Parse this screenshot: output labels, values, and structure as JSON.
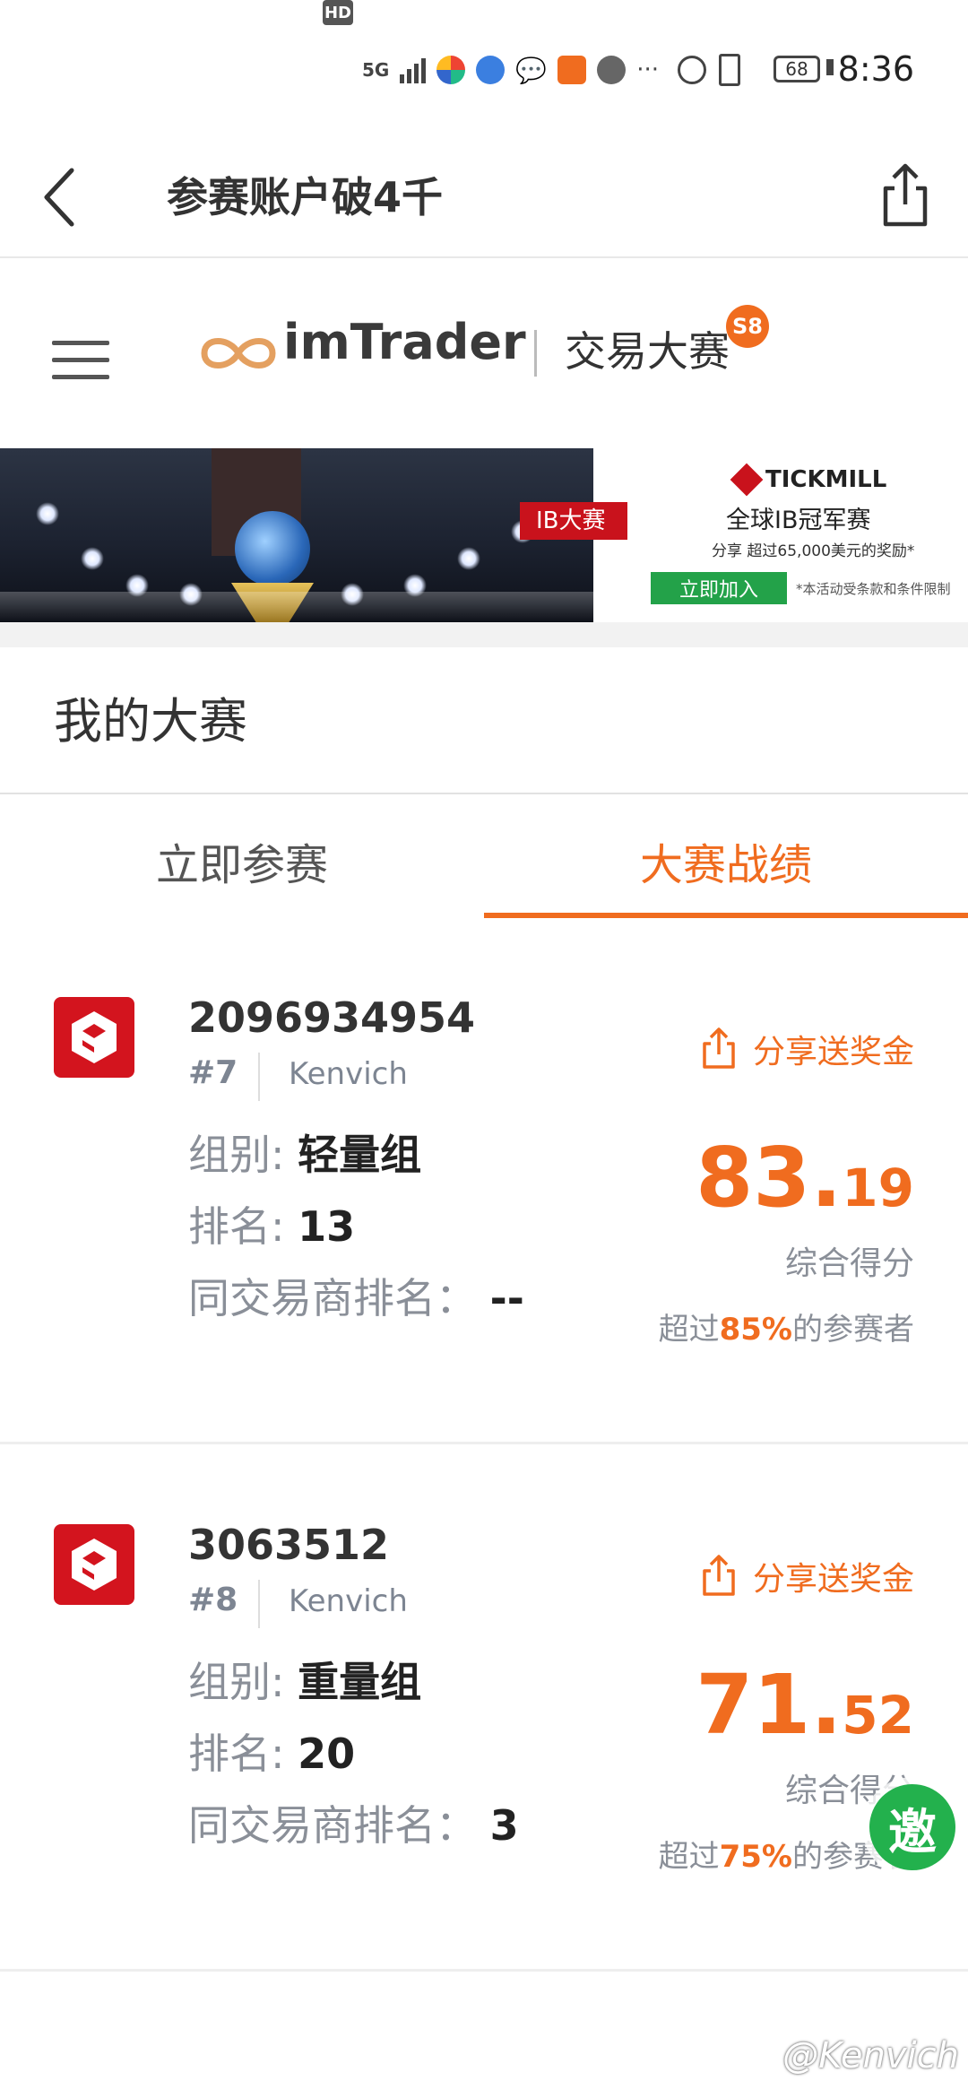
{
  "status_bar": {
    "hd": "HD",
    "signal": "5G",
    "battery": "68",
    "time": "8:36",
    "more": "···"
  },
  "nav": {
    "title": "参赛账户破4千"
  },
  "brand": {
    "logo_text": "imTrader",
    "subtitle": "交易大赛",
    "season_badge": "S8",
    "accent_color": "#f06c1f"
  },
  "banner": {
    "tag": "IB大赛",
    "sponsor": "TICKMILL",
    "title": "全球IB冠军赛",
    "desc": "分享 超过65,000美元的奖励*",
    "join": "立即加入",
    "note": "*本活动受条款和条件限制"
  },
  "section": {
    "title": "我的大赛"
  },
  "tabs": [
    {
      "label": "立即参赛",
      "active": false
    },
    {
      "label": "大赛战绩",
      "active": true
    }
  ],
  "labels": {
    "group": "组别:",
    "rank": "排名:",
    "broker_rank": "同交易商排名：",
    "share_prize": "分享送奖金",
    "score_label": "综合得分",
    "beat_prefix": "超过",
    "beat_suffix": "的参赛者"
  },
  "accounts": [
    {
      "id": "2096934954",
      "rank_tag": "#7",
      "name": "Kenvich",
      "group": "轻量组",
      "rank": "13",
      "broker_rank": "--",
      "score_int": "83.",
      "score_dec": "19",
      "beat_pct": "85%"
    },
    {
      "id": "3063512",
      "rank_tag": "#8",
      "name": "Kenvich",
      "group": "重量组",
      "rank": "20",
      "broker_rank": "3",
      "score_int": "71.",
      "score_dec": "52",
      "beat_pct": "75%"
    }
  ],
  "float_button": "邀",
  "watermark": "@Kenvich"
}
